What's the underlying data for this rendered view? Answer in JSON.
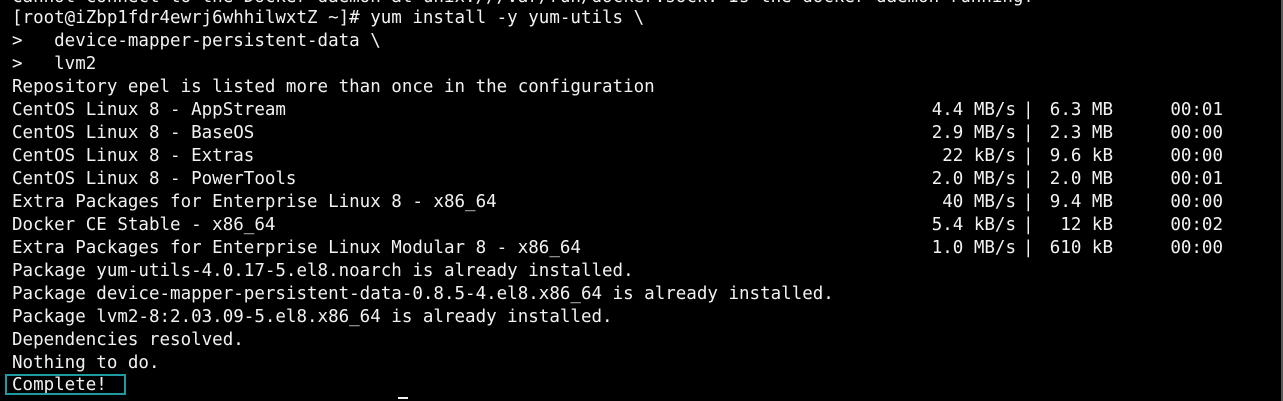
{
  "terminal": {
    "top_line": "Cannot connect to the Docker daemon at unix:///var/run/docker.sock. Is the docker daemon running?",
    "command": "[root@iZbp1fdr4ewrj6whhilwxtZ ~]# yum install -y yum-utils \\",
    "cont1": ">   device-mapper-persistent-data \\",
    "cont2": ">   lvm2",
    "repo_warning": "Repository epel is listed more than once in the configuration",
    "repos": [
      {
        "name": "CentOS Linux 8 - AppStream",
        "speed": "4.4 MB/s",
        "size": "6.3 MB",
        "time": "00:01"
      },
      {
        "name": "CentOS Linux 8 - BaseOS",
        "speed": "2.9 MB/s",
        "size": "2.3 MB",
        "time": "00:00"
      },
      {
        "name": "CentOS Linux 8 - Extras",
        "speed": "22 kB/s",
        "size": "9.6 kB",
        "time": "00:00"
      },
      {
        "name": "CentOS Linux 8 - PowerTools",
        "speed": "2.0 MB/s",
        "size": "2.0 MB",
        "time": "00:01"
      },
      {
        "name": "Extra Packages for Enterprise Linux 8 - x86_64",
        "speed": "40 MB/s",
        "size": "9.4 MB",
        "time": "00:00"
      },
      {
        "name": "Docker CE Stable - x86_64",
        "speed": "5.4 kB/s",
        "size": "12 kB",
        "time": "00:02"
      },
      {
        "name": "Extra Packages for Enterprise Linux Modular 8 - x86_64",
        "speed": "1.0 MB/s",
        "size": "610 kB",
        "time": "00:00"
      }
    ],
    "separator": "|",
    "pkg1": "Package yum-utils-4.0.17-5.el8.noarch is already installed.",
    "pkg2": "Package device-mapper-persistent-data-0.8.5-4.el8.x86_64 is already installed.",
    "pkg3": "Package lvm2-8:2.03.09-5.el8.x86_64 is already installed.",
    "deps": "Dependencies resolved.",
    "nothing": "Nothing to do.",
    "complete": "Complete!"
  },
  "colors": {
    "background": "#000000",
    "text": "#f2f2f2",
    "highlight_border": "#1f9aa0"
  }
}
